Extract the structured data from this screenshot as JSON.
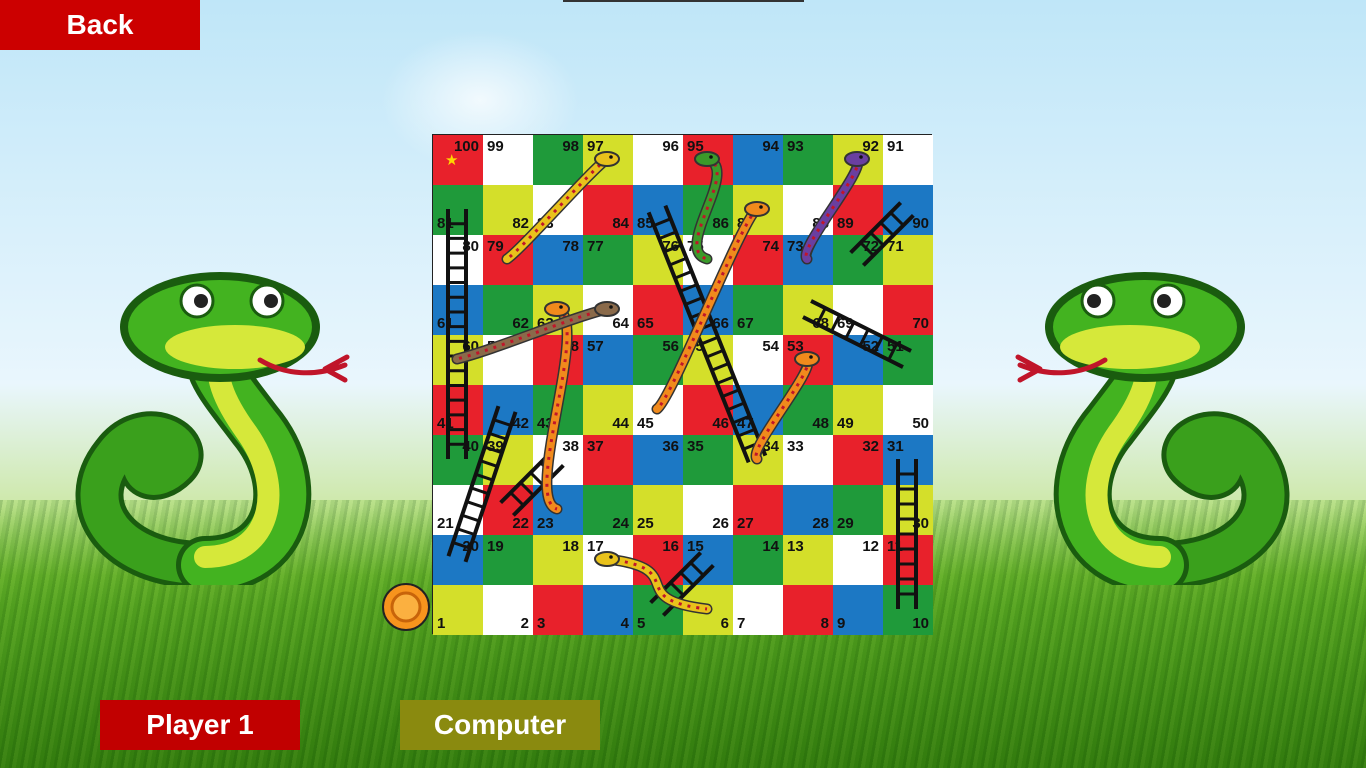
{
  "buttons": {
    "back_label": "Back",
    "player1_label": "Player 1",
    "computer_label": "Computer"
  },
  "colors": {
    "red": "#e8212b",
    "green": "#1f9a3a",
    "yellow": "#d4df2a",
    "blue": "#1c78c4",
    "white": "#ffffff",
    "back_button": "#cc0000",
    "player_button": "#c10000",
    "computer_button": "#8a8a0f",
    "token": "#f7941d"
  },
  "board": {
    "rows": [
      {
        "cells": [
          {
            "n": "100",
            "c": "red"
          },
          {
            "n": "99",
            "c": "white"
          },
          {
            "n": "98",
            "c": "green"
          },
          {
            "n": "97",
            "c": "yellow"
          },
          {
            "n": "96",
            "c": "white"
          },
          {
            "n": "95",
            "c": "red"
          },
          {
            "n": "94",
            "c": "blue"
          },
          {
            "n": "93",
            "c": "green"
          },
          {
            "n": "92",
            "c": "yellow"
          },
          {
            "n": "91",
            "c": "white"
          }
        ]
      },
      {
        "cells": [
          {
            "n": "81",
            "c": "green"
          },
          {
            "n": "82",
            "c": "yellow"
          },
          {
            "n": "83",
            "c": "white"
          },
          {
            "n": "84",
            "c": "red"
          },
          {
            "n": "85",
            "c": "blue"
          },
          {
            "n": "86",
            "c": "green"
          },
          {
            "n": "87",
            "c": "yellow"
          },
          {
            "n": "88",
            "c": "white"
          },
          {
            "n": "89",
            "c": "red"
          },
          {
            "n": "90",
            "c": "blue"
          }
        ]
      },
      {
        "cells": [
          {
            "n": "80",
            "c": "white"
          },
          {
            "n": "79",
            "c": "red"
          },
          {
            "n": "78",
            "c": "blue"
          },
          {
            "n": "77",
            "c": "green"
          },
          {
            "n": "76",
            "c": "yellow"
          },
          {
            "n": "75",
            "c": "white"
          },
          {
            "n": "74",
            "c": "red"
          },
          {
            "n": "73",
            "c": "blue"
          },
          {
            "n": "72",
            "c": "green"
          },
          {
            "n": "71",
            "c": "yellow"
          }
        ]
      },
      {
        "cells": [
          {
            "n": "61",
            "c": "blue"
          },
          {
            "n": "62",
            "c": "green"
          },
          {
            "n": "63",
            "c": "yellow"
          },
          {
            "n": "64",
            "c": "white"
          },
          {
            "n": "65",
            "c": "red"
          },
          {
            "n": "66",
            "c": "blue"
          },
          {
            "n": "67",
            "c": "green"
          },
          {
            "n": "68",
            "c": "yellow"
          },
          {
            "n": "69",
            "c": "white"
          },
          {
            "n": "70",
            "c": "red"
          }
        ]
      },
      {
        "cells": [
          {
            "n": "60",
            "c": "yellow"
          },
          {
            "n": "59",
            "c": "white"
          },
          {
            "n": "58",
            "c": "red"
          },
          {
            "n": "57",
            "c": "blue"
          },
          {
            "n": "56",
            "c": "green"
          },
          {
            "n": "55",
            "c": "yellow"
          },
          {
            "n": "54",
            "c": "white"
          },
          {
            "n": "53",
            "c": "red"
          },
          {
            "n": "52",
            "c": "blue"
          },
          {
            "n": "51",
            "c": "green"
          }
        ]
      },
      {
        "cells": [
          {
            "n": "41",
            "c": "red"
          },
          {
            "n": "42",
            "c": "blue"
          },
          {
            "n": "43",
            "c": "green"
          },
          {
            "n": "44",
            "c": "yellow"
          },
          {
            "n": "45",
            "c": "white"
          },
          {
            "n": "46",
            "c": "red"
          },
          {
            "n": "47",
            "c": "blue"
          },
          {
            "n": "48",
            "c": "green"
          },
          {
            "n": "49",
            "c": "yellow"
          },
          {
            "n": "50",
            "c": "white"
          }
        ]
      },
      {
        "cells": [
          {
            "n": "40",
            "c": "green"
          },
          {
            "n": "39",
            "c": "yellow"
          },
          {
            "n": "38",
            "c": "white"
          },
          {
            "n": "37",
            "c": "red"
          },
          {
            "n": "36",
            "c": "blue"
          },
          {
            "n": "35",
            "c": "green"
          },
          {
            "n": "34",
            "c": "yellow"
          },
          {
            "n": "33",
            "c": "white"
          },
          {
            "n": "32",
            "c": "red"
          },
          {
            "n": "31",
            "c": "blue"
          }
        ]
      },
      {
        "cells": [
          {
            "n": "21",
            "c": "white"
          },
          {
            "n": "22",
            "c": "red"
          },
          {
            "n": "23",
            "c": "blue"
          },
          {
            "n": "24",
            "c": "green"
          },
          {
            "n": "25",
            "c": "yellow"
          },
          {
            "n": "26",
            "c": "white"
          },
          {
            "n": "27",
            "c": "red"
          },
          {
            "n": "28",
            "c": "blue"
          },
          {
            "n": "29",
            "c": "green"
          },
          {
            "n": "30",
            "c": "yellow"
          }
        ]
      },
      {
        "cells": [
          {
            "n": "20",
            "c": "blue"
          },
          {
            "n": "19",
            "c": "green"
          },
          {
            "n": "18",
            "c": "yellow"
          },
          {
            "n": "17",
            "c": "white"
          },
          {
            "n": "16",
            "c": "red"
          },
          {
            "n": "15",
            "c": "blue"
          },
          {
            "n": "14",
            "c": "green"
          },
          {
            "n": "13",
            "c": "yellow"
          },
          {
            "n": "12",
            "c": "white"
          },
          {
            "n": "11",
            "c": "red"
          }
        ]
      },
      {
        "cells": [
          {
            "n": "1",
            "c": "yellow"
          },
          {
            "n": "2",
            "c": "white"
          },
          {
            "n": "3",
            "c": "red"
          },
          {
            "n": "4",
            "c": "blue"
          },
          {
            "n": "5",
            "c": "green"
          },
          {
            "n": "6",
            "c": "yellow"
          },
          {
            "n": "7",
            "c": "white"
          },
          {
            "n": "8",
            "c": "red"
          },
          {
            "n": "9",
            "c": "blue"
          },
          {
            "n": "10",
            "c": "green"
          }
        ]
      }
    ],
    "ladders": [
      {
        "from": "20",
        "to": "42"
      },
      {
        "from": "40",
        "to": "81"
      },
      {
        "from": "22",
        "to": "38"
      },
      {
        "from": "5",
        "to": "15"
      },
      {
        "from": "10",
        "to": "31"
      },
      {
        "from": "34",
        "to": "85"
      },
      {
        "from": "51",
        "to": "68"
      },
      {
        "from": "72",
        "to": "90"
      }
    ],
    "snakes": [
      {
        "head": "97",
        "tail": "79",
        "color": "yellow"
      },
      {
        "head": "95",
        "tail": "75",
        "color": "green"
      },
      {
        "head": "87",
        "tail": "45",
        "color": "orange"
      },
      {
        "head": "92",
        "tail": "73",
        "color": "purple"
      },
      {
        "head": "63",
        "tail": "23",
        "color": "orange"
      },
      {
        "head": "64",
        "tail": "60",
        "color": "brown"
      },
      {
        "head": "53",
        "tail": "34",
        "color": "orange"
      },
      {
        "head": "17",
        "tail": "6",
        "color": "yellow"
      }
    ],
    "star_icon": "star-icon"
  }
}
